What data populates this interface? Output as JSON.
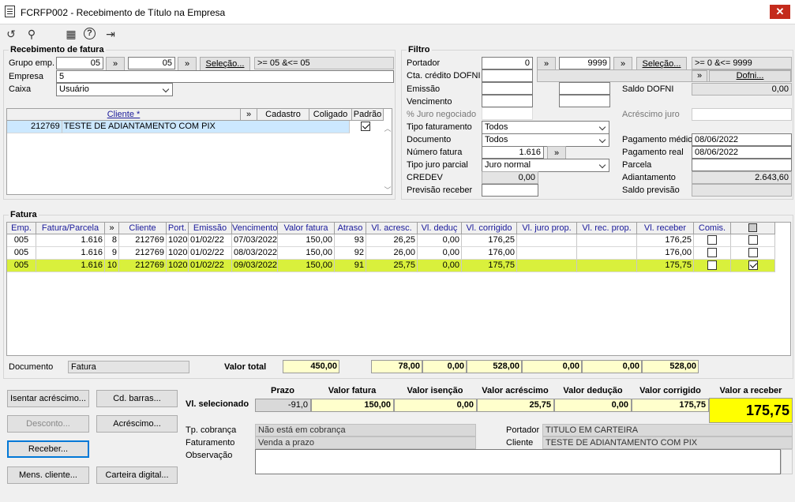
{
  "window": {
    "title": "FCRFP002 - Recebimento de Título na Empresa",
    "close": "✕"
  },
  "toolbar": {
    "refresh": "↺",
    "search": "⚲",
    "calendar": "▦",
    "help": "?",
    "exit": "⇥"
  },
  "receb": {
    "title": "Recebimento de fatura",
    "grupo_label": "Grupo emp.",
    "grupo_from": "05",
    "grupo_to": "05",
    "arrow": "»",
    "selecao_btn": "Seleção...",
    "grupo_range": ">= 05 &<= 05",
    "empresa_label": "Empresa",
    "empresa_value": "5",
    "caixa_label": "Caixa",
    "caixa_value": "Usuário",
    "grid_headers": {
      "cliente": "Cliente *",
      "arrow": "»",
      "cadastro": "Cadastro",
      "coligado": "Coligado",
      "padrao": "Padrão"
    },
    "rows": [
      {
        "code": "212769",
        "name": "TESTE DE ADIANTAMENTO COM PIX"
      }
    ]
  },
  "filtro": {
    "title": "Filtro",
    "portador_label": "Portador",
    "portador_from": "0",
    "portador_to": "9999",
    "arrow": "»",
    "selecao_btn": "Seleção...",
    "portador_range": ">= 0 &<= 9999",
    "cta_label": "Cta. crédito DOFNI",
    "dofni_btn": "Dofni...",
    "emissao_label": "Emissão",
    "saldo_dofni_label": "Saldo DOFNI",
    "saldo_dofni_value": "0,00",
    "vencimento_label": "Vencimento",
    "juro_neg_label": "% Juro negociado",
    "acresc_juro_label": "Acréscimo juro",
    "tipo_fat_label": "Tipo faturamento",
    "tipo_fat_value": "Todos",
    "pag_medio_label": "Pagamento médio",
    "pag_medio_value": "08/06/2022",
    "documento_label": "Documento",
    "documento_value": "Todos",
    "pag_real_label": "Pagamento real",
    "pag_real_value": "08/06/2022",
    "num_fatura_label": "Número fatura",
    "num_fatura_value": "1.616",
    "parcela_label": "Parcela",
    "tipo_juro_label": "Tipo juro parcial",
    "tipo_juro_value": "Juro normal",
    "adiantamento_label": "Adiantamento",
    "adiantamento_value": "2.643,60",
    "credev_label": "CREDEV",
    "credev_value": "0,00",
    "prev_receber_label": "Previsão receber",
    "saldo_prev_label": "Saldo previsão"
  },
  "fatura": {
    "title": "Fatura",
    "headers": [
      "Emp.",
      "Fatura/Parcela",
      "»",
      "Cliente",
      "Port.",
      "Emissão",
      "Vencimento",
      "Valor fatura",
      "Atraso",
      "Vl. acresc.",
      "Vl. deduç",
      "Vl. corrigido",
      "Vl. juro prop.",
      "Vl. rec. prop.",
      "Vl. receber",
      "Comis.",
      ""
    ],
    "rows": [
      {
        "emp": "005",
        "fatura": "1.616",
        "parcela": "8",
        "cliente": "212769",
        "port": "1020",
        "emissao": "01/02/22",
        "vencimento": "07/03/2022",
        "valor": "150,00",
        "atraso": "93",
        "acresc": "26,25",
        "deduc": "0,00",
        "corrigido": "176,25",
        "juro": "",
        "rec": "",
        "receber": "176,25"
      },
      {
        "emp": "005",
        "fatura": "1.616",
        "parcela": "9",
        "cliente": "212769",
        "port": "1020",
        "emissao": "01/02/22",
        "vencimento": "08/03/2022",
        "valor": "150,00",
        "atraso": "92",
        "acresc": "26,00",
        "deduc": "0,00",
        "corrigido": "176,00",
        "juro": "",
        "rec": "",
        "receber": "176,00"
      },
      {
        "emp": "005",
        "fatura": "1.616",
        "parcela": "10",
        "cliente": "212769",
        "port": "1020",
        "emissao": "01/02/22",
        "vencimento": "09/03/2022",
        "valor": "150,00",
        "atraso": "91",
        "acresc": "25,75",
        "deduc": "0,00",
        "corrigido": "175,75",
        "juro": "",
        "rec": "",
        "receber": "175,75"
      }
    ],
    "selected_row": 2,
    "documento_label": "Documento",
    "documento_value": "Fatura",
    "valor_total_label": "Valor total",
    "totals": {
      "valor": "450,00",
      "acresc": "78,00",
      "deduc": "0,00",
      "corrigido": "528,00",
      "juro": "0,00",
      "rec": "0,00",
      "receber": "528,00"
    }
  },
  "summary": {
    "headers": {
      "prazo": "Prazo",
      "valor_fatura": "Valor fatura",
      "isencao": "Valor isenção",
      "acrescimo": "Valor acréscimo",
      "deducao": "Valor dedução",
      "corrigido": "Valor corrigido",
      "receber": "Valor a receber"
    },
    "label": "Vl. selecionado",
    "values": {
      "prazo": "-91,0",
      "valor_fatura": "150,00",
      "isencao": "0,00",
      "acrescimo": "25,75",
      "deducao": "0,00",
      "corrigido": "175,75",
      "receber": "175,75"
    },
    "tp_cobranca_label": "Tp. cobrança",
    "tp_cobranca_value": "Não está em cobrança",
    "faturamento_label": "Faturamento",
    "faturamento_value": "Venda a prazo",
    "observacao_label": "Observação",
    "portador_label": "Portador",
    "portador_value": "TITULO EM CARTEIRA",
    "cliente_label": "Cliente",
    "cliente_value": "TESTE DE ADIANTAMENTO COM PIX"
  },
  "buttons": {
    "isentar": "Isentar acréscimo...",
    "cd_barras": "Cd. barras...",
    "desconto": "Desconto...",
    "acrescimo": "Acréscimo...",
    "receber": "Receber...",
    "mens_cliente": "Mens. cliente...",
    "carteira": "Carteira digital..."
  },
  "colors": {
    "selected_row": "#d9f03c",
    "yellow_total": "#ffffcc",
    "big_value": "#ffff00"
  }
}
